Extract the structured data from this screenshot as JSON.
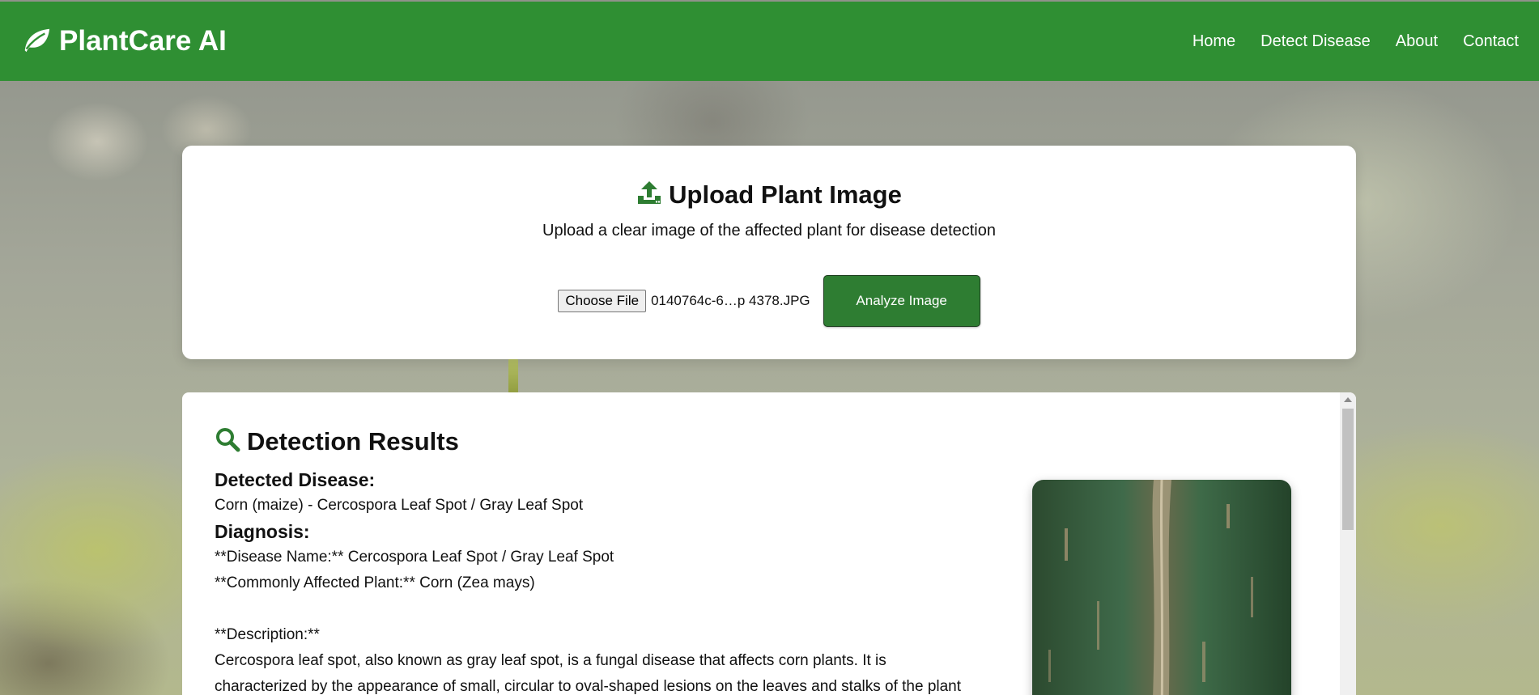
{
  "header": {
    "brand": "PlantCare AI",
    "brand_icon": "leaf-icon",
    "nav": [
      "Home",
      "Detect Disease",
      "About",
      "Contact"
    ]
  },
  "upload": {
    "icon": "upload-icon",
    "title": "Upload Plant Image",
    "subtitle": "Upload a clear image of the affected plant for disease detection",
    "choose_label": "Choose File",
    "file_name": "0140764c-6…p 4378.JPG",
    "analyze_label": "Analyze Image"
  },
  "results": {
    "icon": "search-icon",
    "title": "Detection Results",
    "detected_heading": "Detected Disease:",
    "detected_value": "Corn (maize) - Cercospora Leaf Spot / Gray Leaf Spot",
    "diagnosis_heading": "Diagnosis:",
    "lines": [
      "**Disease Name:** Cercospora Leaf Spot / Gray Leaf Spot",
      "**Commonly Affected Plant:** Corn (Zea mays)",
      "**Description:**",
      "Cercospora leaf spot, also known as gray leaf spot, is a fungal disease that affects corn plants. It is",
      "characterized by the appearance of small, circular to oval-shaped lesions on the leaves and stalks of the plant"
    ]
  },
  "colors": {
    "header": "#2f8f33",
    "accent": "#2e7d32"
  }
}
